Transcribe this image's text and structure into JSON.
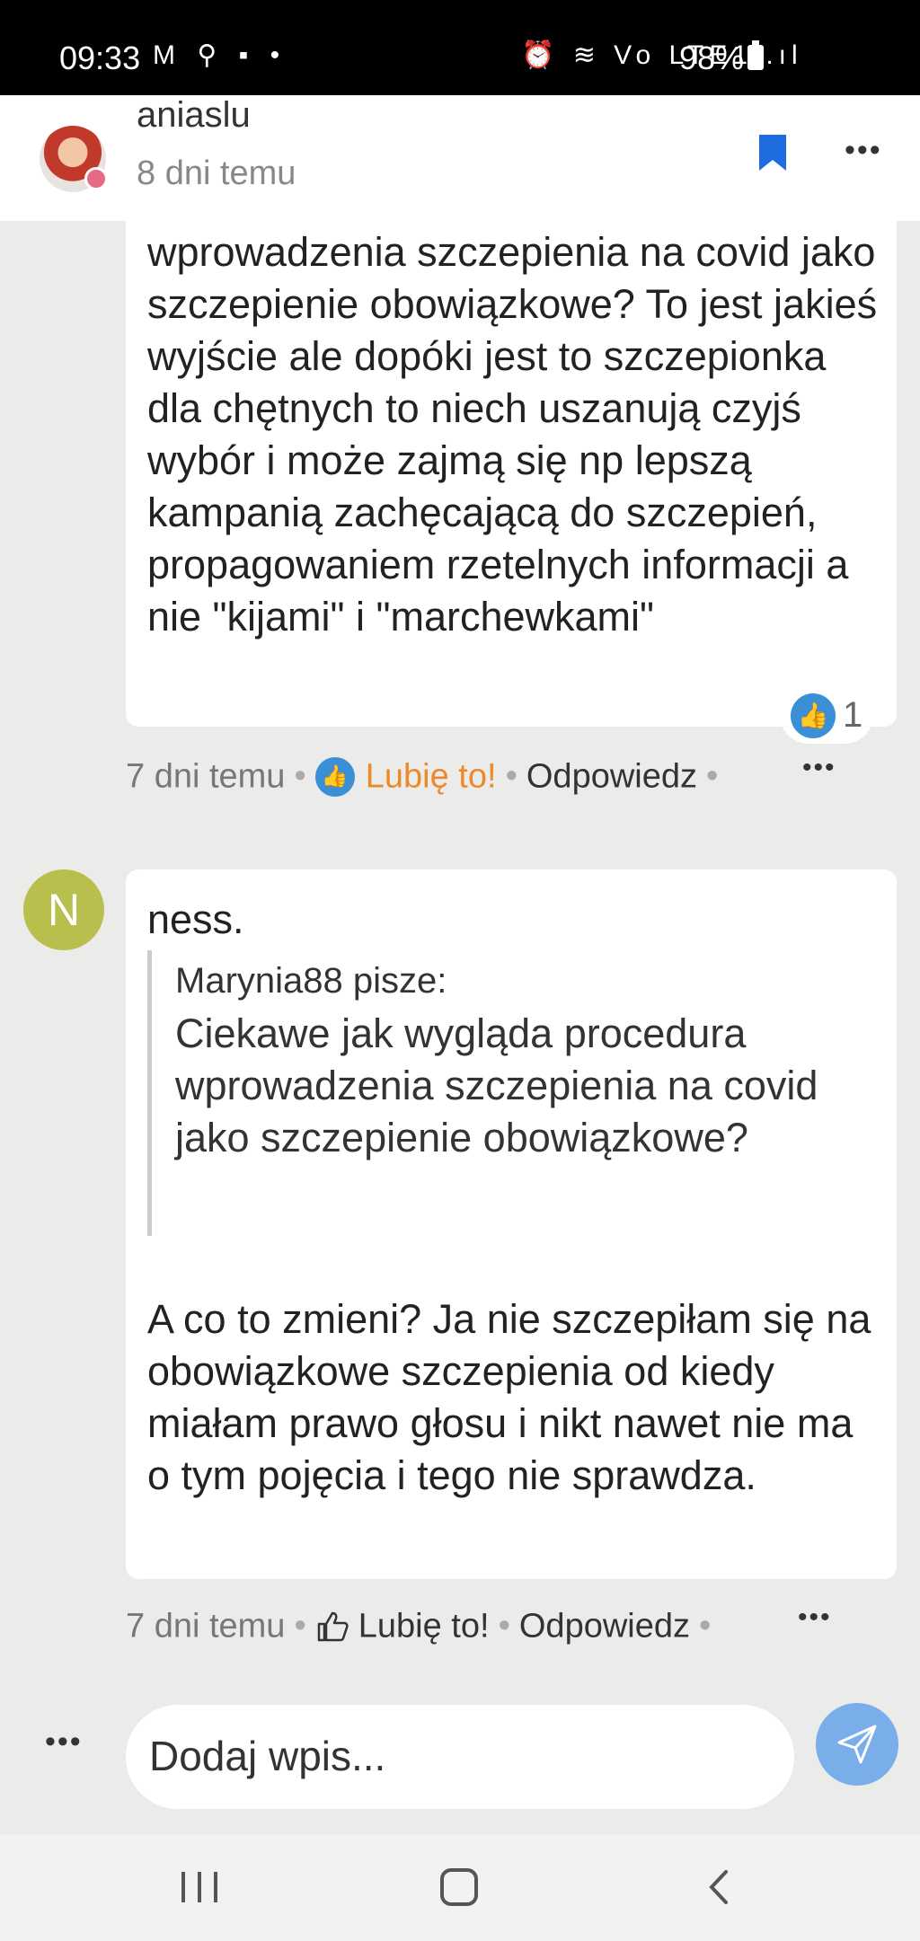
{
  "status_bar": {
    "time": "09:33",
    "left_icons": "M ⚲ ▪ •",
    "right_icons": "⏰ ≋ Vo LTE1 .ıl",
    "battery": "98%"
  },
  "header": {
    "username": "aniaslu",
    "time_ago": "8 dni temu",
    "bookmark_icon": "bookmark-icon",
    "more_label": "•••",
    "accent_color": "#1e6ce0"
  },
  "comment1": {
    "text": "wprowadzenia szczepienia na covid jako szczepienie obowiązkowe? To jest jakieś wyjście ale dopóki jest to szczepionka dla chętnych to niech uszanują czyjś wybór i może zajmą się np lepszą kampanią zachęcającą do szczepień, propagowaniem rzetelnych informacji a nie \"kijami\" i \"marchewkami\"",
    "like_count": "1",
    "meta": {
      "time_ago": "7 dni temu",
      "like_label": "Lubię to!",
      "reply_label": "Odpowiedz",
      "more_label": "•••"
    }
  },
  "comment2": {
    "avatar_letter": "N",
    "author": "ness.",
    "quote": {
      "author": "Marynia88 pisze:",
      "text": "Ciekawe jak wygląda procedura wprowadzenia szczepienia na covid jako szczepienie obowiązkowe?"
    },
    "text": "A co to zmieni? Ja nie szczepiłam się na obowiązkowe szczepienia od kiedy miałam prawo głosu i nikt nawet nie ma o tym pojęcia i tego nie sprawdza.",
    "meta": {
      "time_ago": "7 dni temu",
      "like_label": "Lubię to!",
      "reply_label": "Odpowiedz",
      "more_label": "•••"
    }
  },
  "composer": {
    "more_label": "•••",
    "placeholder": "Dodaj wpis...",
    "send_icon": "send-icon"
  },
  "nav_bar": {
    "recent_icon": "recent-apps-icon",
    "home_icon": "home-icon",
    "back_icon": "back-icon"
  }
}
